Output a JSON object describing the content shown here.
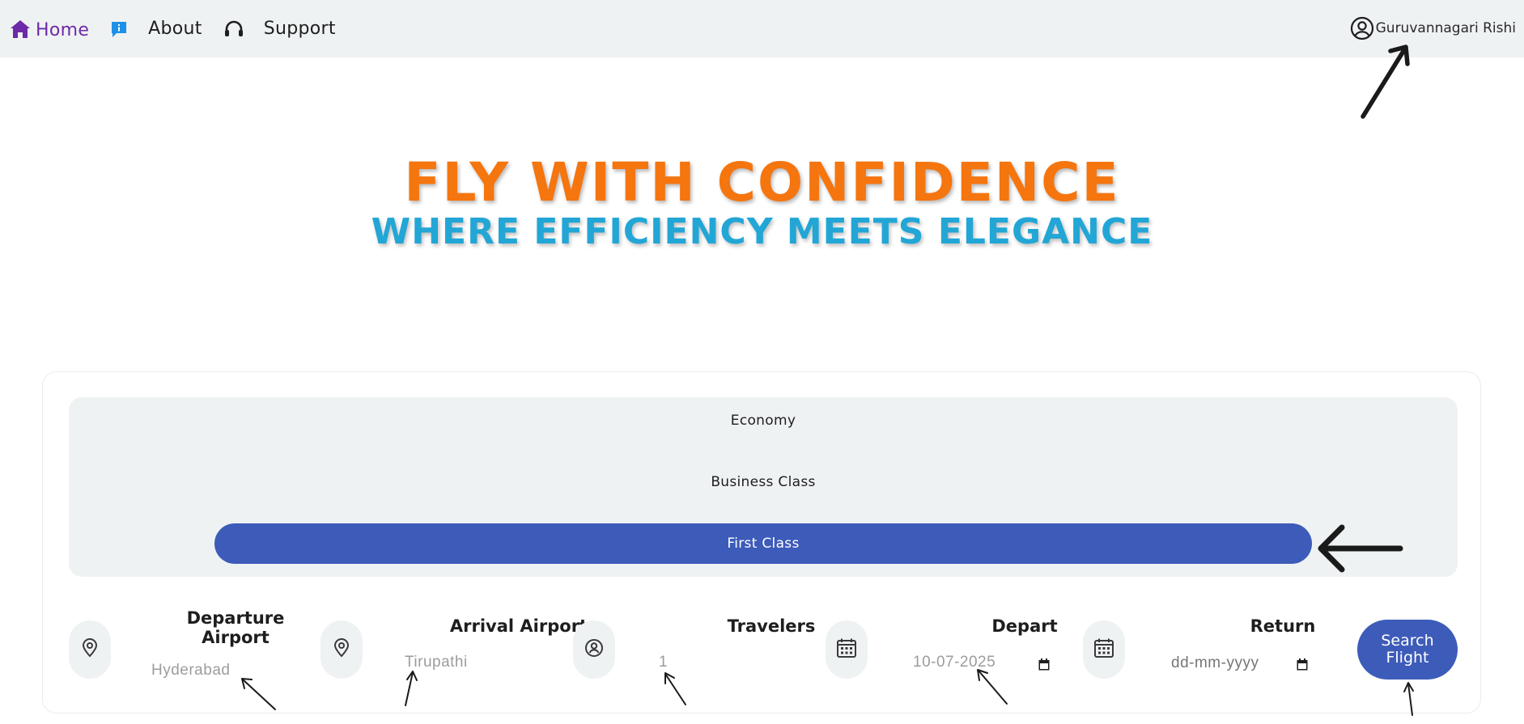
{
  "nav": {
    "home_label": "Home",
    "about_label": "About",
    "support_label": "Support",
    "user_name": "Guruvannagari Rishi",
    "icons": {
      "home": "home-icon",
      "about": "info-icon",
      "support": "headset-icon",
      "user": "user-circle-icon"
    }
  },
  "hero": {
    "title": "FLY WITH CONFIDENCE",
    "subtitle": "WHERE EFFICIENCY MEETS ELEGANCE"
  },
  "class_options": [
    {
      "label": "Economy",
      "selected": false
    },
    {
      "label": "Business Class",
      "selected": false
    },
    {
      "label": "First Class",
      "selected": true
    }
  ],
  "fields": {
    "departure": {
      "heading_line1": "Departure",
      "heading_line2": "Airport",
      "value": "Hyderabad",
      "icon": "map-pin-icon"
    },
    "arrival": {
      "heading": "Arrival Airport",
      "value": "Tirupathi",
      "icon": "map-pin-icon"
    },
    "travelers": {
      "heading": "Travelers",
      "value": "1",
      "icon": "user-pin-icon"
    },
    "depart": {
      "heading": "Depart",
      "value": "10-07-2025",
      "icon": "calendar-icon"
    },
    "return": {
      "heading": "Return",
      "placeholder": "dd-mm-yyyy",
      "icon": "calendar-icon"
    }
  },
  "search_button": {
    "line1": "Search",
    "line2": "Flight"
  },
  "colors": {
    "nav_bg": "#eff2f3",
    "home_accent": "#6d2aa8",
    "hero_title": "#f5750f",
    "hero_subtitle": "#22a6d6",
    "primary_blue": "#3d5bb8",
    "panel_bg": "#eff2f3",
    "muted_text": "#9c9c9c"
  }
}
